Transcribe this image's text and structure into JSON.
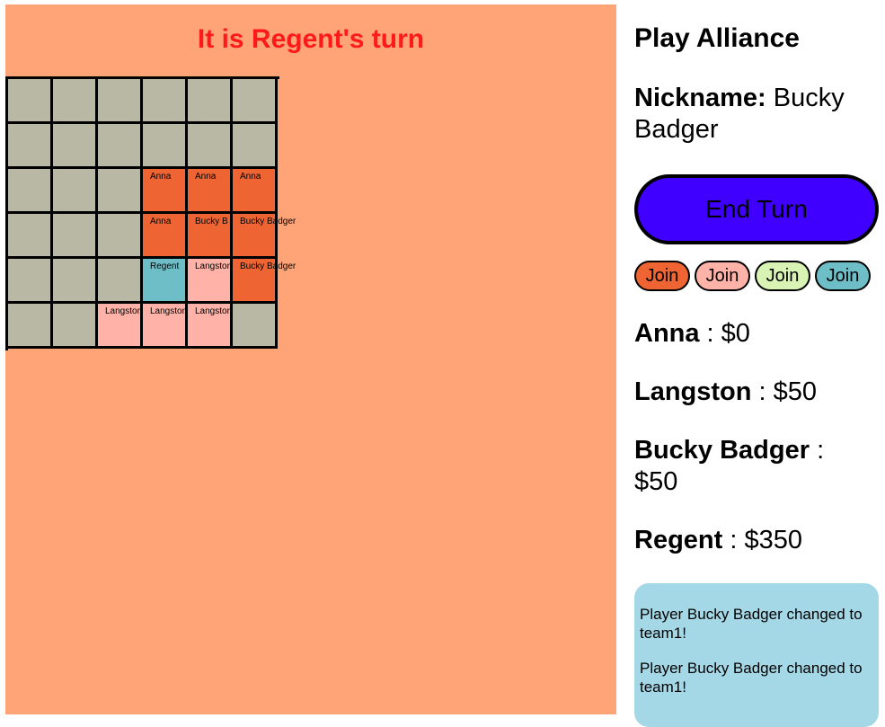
{
  "turn_banner": "It is Regent's turn",
  "app_title": "Play Alliance",
  "nickname": {
    "label": "Nickname:",
    "value": "Bucky Badger"
  },
  "end_turn_label": "End Turn",
  "colors": {
    "game_bg": "#ffa477",
    "empty": "#b8b8a4",
    "team1": "#ee6533",
    "team2": "#ffb3a8",
    "team3": "#d8f3b3",
    "team4": "#6ebec8",
    "end_turn": "#4000ff",
    "log_bg": "#a5d8e6",
    "banner_text": "#ff1a1a"
  },
  "join_buttons": [
    {
      "label": "Join",
      "team": "team1"
    },
    {
      "label": "Join",
      "team": "team2"
    },
    {
      "label": "Join",
      "team": "team3"
    },
    {
      "label": "Join",
      "team": "team4"
    }
  ],
  "scores": [
    {
      "name": "Anna",
      "amount": "$0"
    },
    {
      "name": "Langston",
      "amount": "$50"
    },
    {
      "name": "Bucky Badger",
      "amount": "$50"
    },
    {
      "name": "Regent",
      "amount": "$350"
    }
  ],
  "board": [
    [
      {
        "owner": "",
        "team": "empty"
      },
      {
        "owner": "",
        "team": "empty"
      },
      {
        "owner": "",
        "team": "empty"
      },
      {
        "owner": "",
        "team": "empty"
      },
      {
        "owner": "",
        "team": "empty"
      },
      {
        "owner": "",
        "team": "empty"
      }
    ],
    [
      {
        "owner": "",
        "team": "empty"
      },
      {
        "owner": "",
        "team": "empty"
      },
      {
        "owner": "",
        "team": "empty"
      },
      {
        "owner": "",
        "team": "empty"
      },
      {
        "owner": "",
        "team": "empty"
      },
      {
        "owner": "",
        "team": "empty"
      }
    ],
    [
      {
        "owner": "",
        "team": "empty"
      },
      {
        "owner": "",
        "team": "empty"
      },
      {
        "owner": "",
        "team": "empty"
      },
      {
        "owner": "Anna",
        "team": "team1"
      },
      {
        "owner": "Anna",
        "team": "team1"
      },
      {
        "owner": "Anna",
        "team": "team1"
      }
    ],
    [
      {
        "owner": "",
        "team": "empty"
      },
      {
        "owner": "",
        "team": "empty"
      },
      {
        "owner": "",
        "team": "empty"
      },
      {
        "owner": "Anna",
        "team": "team1"
      },
      {
        "owner": "Bucky B",
        "team": "team1"
      },
      {
        "owner": "Bucky Badger",
        "team": "team1"
      }
    ],
    [
      {
        "owner": "",
        "team": "empty"
      },
      {
        "owner": "",
        "team": "empty"
      },
      {
        "owner": "",
        "team": "empty"
      },
      {
        "owner": "Regent",
        "team": "team4"
      },
      {
        "owner": "Langston",
        "team": "team2"
      },
      {
        "owner": "Bucky Badger",
        "team": "team1"
      }
    ],
    [
      {
        "owner": "",
        "team": "empty"
      },
      {
        "owner": "",
        "team": "empty"
      },
      {
        "owner": "Langston",
        "team": "team2"
      },
      {
        "owner": "Langston",
        "team": "team2"
      },
      {
        "owner": "Langston",
        "team": "team2"
      },
      {
        "owner": "",
        "team": "empty"
      }
    ]
  ],
  "log_messages": [
    "Player Bucky Badger changed to team1!",
    "Player Bucky Badger changed to team1!"
  ]
}
